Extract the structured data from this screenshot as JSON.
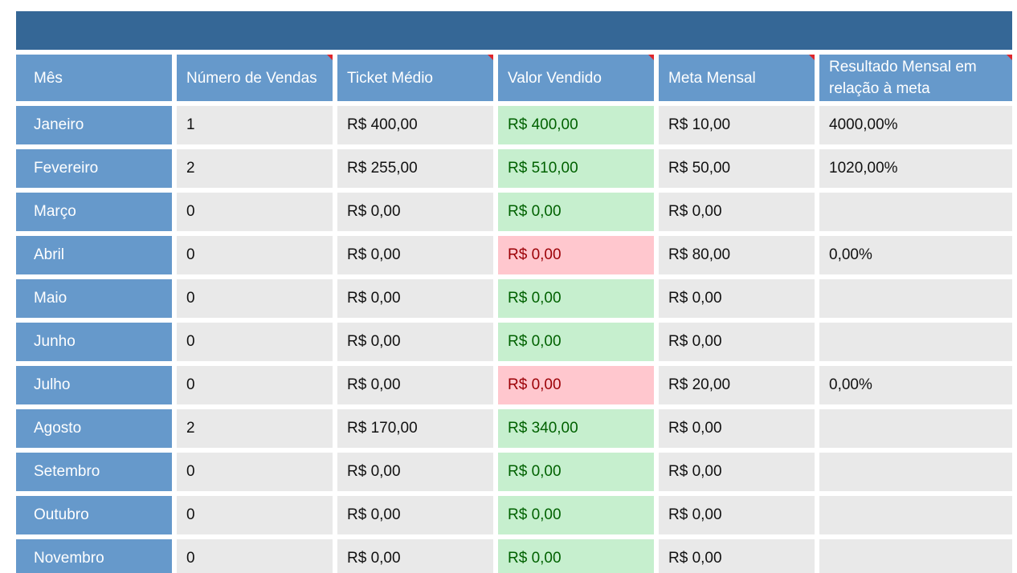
{
  "table": {
    "headers": [
      "Mês",
      "Número de Vendas",
      "Ticket Médio",
      "Valor Vendido",
      "Meta Mensal",
      "Resultado Mensal em relação à meta"
    ],
    "rows": [
      {
        "month": "Janeiro",
        "sales": "1",
        "ticket": "R$ 400,00",
        "sold": "R$ 400,00",
        "sold_status": "met",
        "goal": "R$ 10,00",
        "result": "4000,00%"
      },
      {
        "month": "Fevereiro",
        "sales": "2",
        "ticket": "R$ 255,00",
        "sold": "R$ 510,00",
        "sold_status": "met",
        "goal": "R$ 50,00",
        "result": "1020,00%"
      },
      {
        "month": "Março",
        "sales": "0",
        "ticket": "R$ 0,00",
        "sold": "R$ 0,00",
        "sold_status": "met",
        "goal": "R$ 0,00",
        "result": ""
      },
      {
        "month": "Abril",
        "sales": "0",
        "ticket": "R$ 0,00",
        "sold": "R$ 0,00",
        "sold_status": "missed",
        "goal": "R$ 80,00",
        "result": "0,00%"
      },
      {
        "month": "Maio",
        "sales": "0",
        "ticket": "R$ 0,00",
        "sold": "R$ 0,00",
        "sold_status": "met",
        "goal": "R$ 0,00",
        "result": ""
      },
      {
        "month": "Junho",
        "sales": "0",
        "ticket": "R$ 0,00",
        "sold": "R$ 0,00",
        "sold_status": "met",
        "goal": "R$ 0,00",
        "result": ""
      },
      {
        "month": "Julho",
        "sales": "0",
        "ticket": "R$ 0,00",
        "sold": "R$ 0,00",
        "sold_status": "missed",
        "goal": "R$ 20,00",
        "result": "0,00%"
      },
      {
        "month": "Agosto",
        "sales": "2",
        "ticket": "R$ 170,00",
        "sold": "R$ 340,00",
        "sold_status": "met",
        "goal": "R$ 0,00",
        "result": ""
      },
      {
        "month": "Setembro",
        "sales": "0",
        "ticket": "R$ 0,00",
        "sold": "R$ 0,00",
        "sold_status": "met",
        "goal": "R$ 0,00",
        "result": ""
      },
      {
        "month": "Outubro",
        "sales": "0",
        "ticket": "R$ 0,00",
        "sold": "R$ 0,00",
        "sold_status": "met",
        "goal": "R$ 0,00",
        "result": ""
      },
      {
        "month": "Novembro",
        "sales": "0",
        "ticket": "R$ 0,00",
        "sold": "R$ 0,00",
        "sold_status": "met",
        "goal": "R$ 0,00",
        "result": ""
      }
    ]
  },
  "colors": {
    "title_bar": "#356796",
    "header": "#6699cb",
    "cell": "#e9e9e9",
    "met_fill": "#c6efce",
    "met_text": "#006100",
    "missed_fill": "#ffc7ce",
    "missed_text": "#9c0006",
    "comment_marker": "#e0262b"
  },
  "comment_markers_on_headers": [
    1,
    2,
    3,
    4,
    5
  ]
}
